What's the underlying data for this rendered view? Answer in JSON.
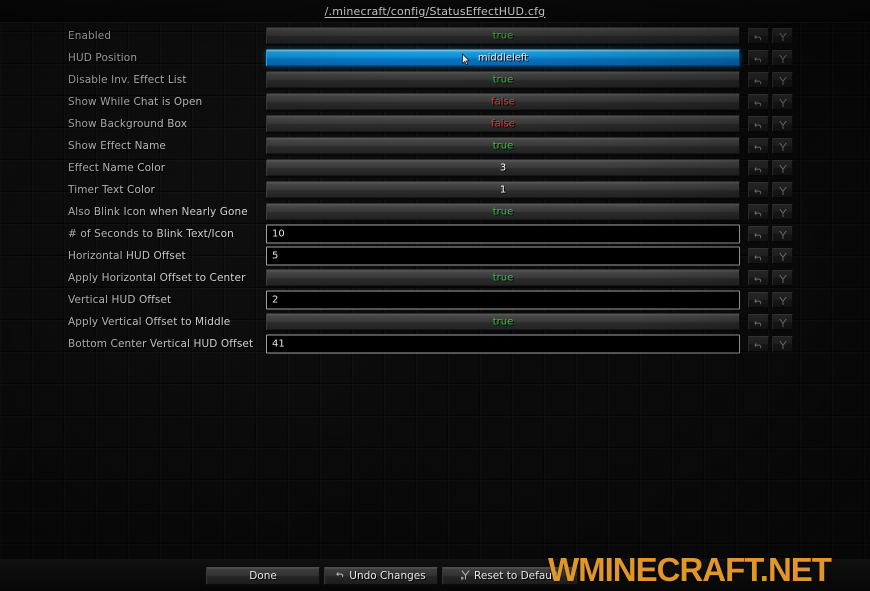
{
  "window": {
    "title": "/.minecraft/config/StatusEffectHUD.cfg"
  },
  "icons": {
    "undo_arrow": "undo-arrow-icon",
    "reset_default": "reset-to-default-icon",
    "cursor": "mouse-cursor-icon"
  },
  "rows": [
    {
      "label": "Enabled",
      "type": "boolean",
      "value": "true",
      "state": "true"
    },
    {
      "label": "HUD Position",
      "type": "enum",
      "value": "middleleft",
      "state": "str",
      "hovered": true
    },
    {
      "label": "Disable Inv. Effect List",
      "type": "boolean",
      "value": "true",
      "state": "true"
    },
    {
      "label": "Show While Chat is Open",
      "type": "boolean",
      "value": "false",
      "state": "false"
    },
    {
      "label": "Show Background Box",
      "type": "boolean",
      "value": "false",
      "state": "false"
    },
    {
      "label": "Show Effect Name",
      "type": "boolean",
      "value": "true",
      "state": "true"
    },
    {
      "label": "Effect Name Color",
      "type": "number",
      "value": "3",
      "state": "num"
    },
    {
      "label": "Timer Text Color",
      "type": "number",
      "value": "1",
      "state": "num"
    },
    {
      "label": "Also Blink Icon when Nearly Gone",
      "type": "boolean",
      "value": "true",
      "state": "true"
    },
    {
      "label": "# of Seconds to Blink Text/Icon",
      "type": "input",
      "value": "10",
      "state": "str"
    },
    {
      "label": "Horizontal HUD Offset",
      "type": "input",
      "value": "5",
      "state": "str"
    },
    {
      "label": "Apply Horizontal Offset to Center",
      "type": "boolean",
      "value": "true",
      "state": "true"
    },
    {
      "label": "Vertical HUD Offset",
      "type": "input",
      "value": "2",
      "state": "str"
    },
    {
      "label": "Apply Vertical Offset to Middle",
      "type": "boolean",
      "value": "true",
      "state": "true"
    },
    {
      "label": "Bottom Center Vertical HUD Offset",
      "type": "input",
      "value": "41",
      "state": "str"
    }
  ],
  "bottom_bar": {
    "done_label": "Done",
    "undo_label": "Undo Changes",
    "reset_label": "Reset to Default"
  },
  "watermark": {
    "text": "WMINECRAFT.NET",
    "color": "#e0962a"
  },
  "colors": {
    "true_green": "#2ecc3f",
    "false_red": "#e03b2e",
    "hover_blue": "#11a0ec",
    "label_gray": "#d6d6d6"
  }
}
